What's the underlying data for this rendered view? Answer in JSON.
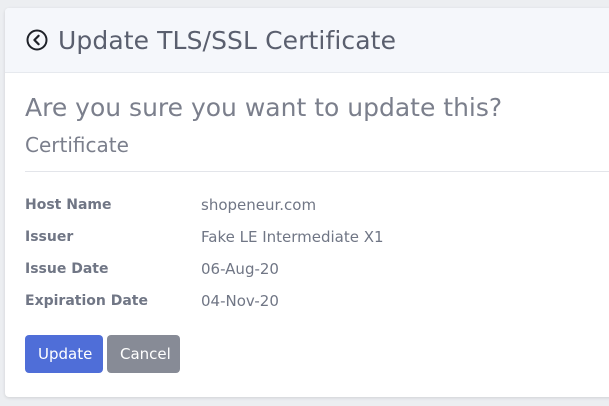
{
  "header": {
    "back_icon": "chevron-left-circle-icon",
    "title": "Update TLS/SSL Certificate"
  },
  "body": {
    "question": "Are you sure you want to update this?",
    "subtitle": "Certificate",
    "details": [
      {
        "label": "Host Name",
        "value": "shopeneur.com"
      },
      {
        "label": "Issuer",
        "value": "Fake LE Intermediate X1"
      },
      {
        "label": "Issue Date",
        "value": "06-Aug-20"
      },
      {
        "label": "Expiration Date",
        "value": "04-Nov-20"
      }
    ]
  },
  "actions": {
    "update_label": "Update",
    "cancel_label": "Cancel"
  },
  "colors": {
    "primary": "#4f6ed8",
    "secondary": "#878b96"
  }
}
